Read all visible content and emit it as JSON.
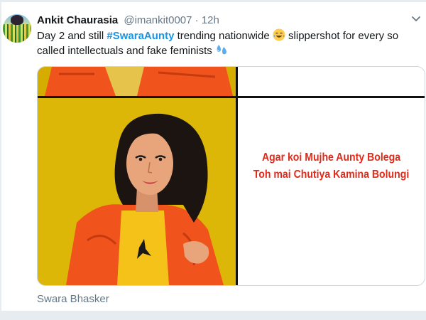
{
  "tweet": {
    "author_name": "Ankit Chaurasia",
    "handle": "@imankit0007",
    "separator": "·",
    "time": "12h",
    "text_part1": "Day 2 and still ",
    "hashtag": "#SwaraAunty",
    "text_part2": " trending nationwide ",
    "text_part3": " slippershot for every so called intellectuals and fake feminists ",
    "emoji1": "joy-emoji",
    "emoji2": "sweat-droplets-emoji"
  },
  "media": {
    "meme_line1": "Agar  koi Mujhe Aunty Bolega",
    "meme_line2": "Toh mai Chutiya Kamina Bolungi",
    "caption": "Swara Bhasker"
  },
  "colors": {
    "hashtag": "#1b95e0",
    "meme_text": "#e02a1a",
    "meme_background": "#dcb707",
    "jacket": "#f0541c"
  }
}
